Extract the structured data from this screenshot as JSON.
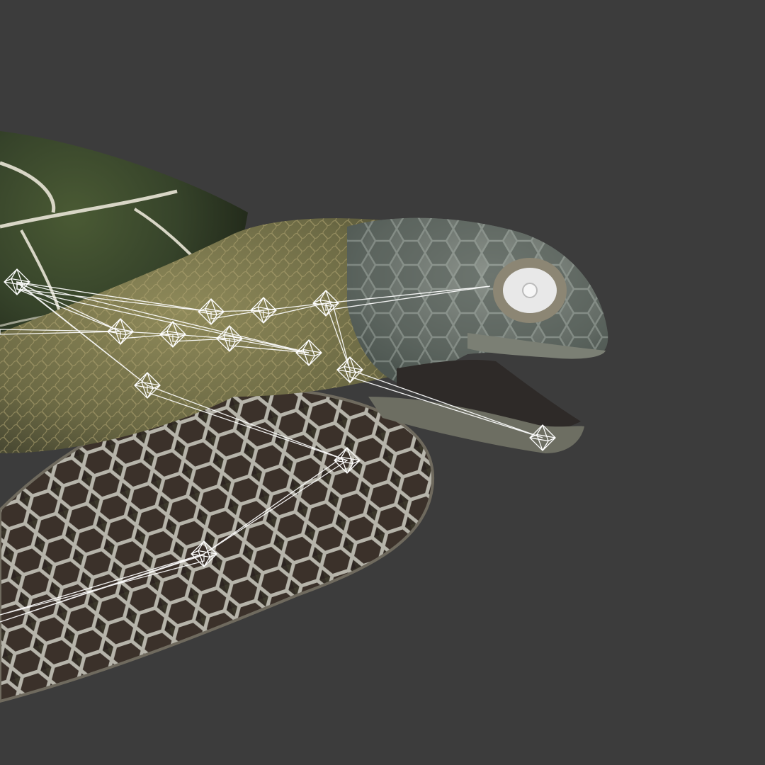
{
  "viewport": {
    "background_color": "#3c3c3c"
  },
  "model": {
    "subject": "sea-turtle",
    "colors": {
      "shell": "#3c4a2c",
      "shell_dark": "#2c3522",
      "skin": "#6d6c48",
      "skin_light": "#8a8757",
      "head": "#6e7670",
      "head_plate": "#4e5751",
      "eye_white": "#e8e8e8",
      "flipper": "#3a2f2a",
      "flipper_scale_line": "#b9b8b0",
      "shell_seam": "#d8d6c6"
    }
  },
  "armature": {
    "style": "octahedral-bones",
    "color": "#ffffff",
    "joint_count": 15
  }
}
